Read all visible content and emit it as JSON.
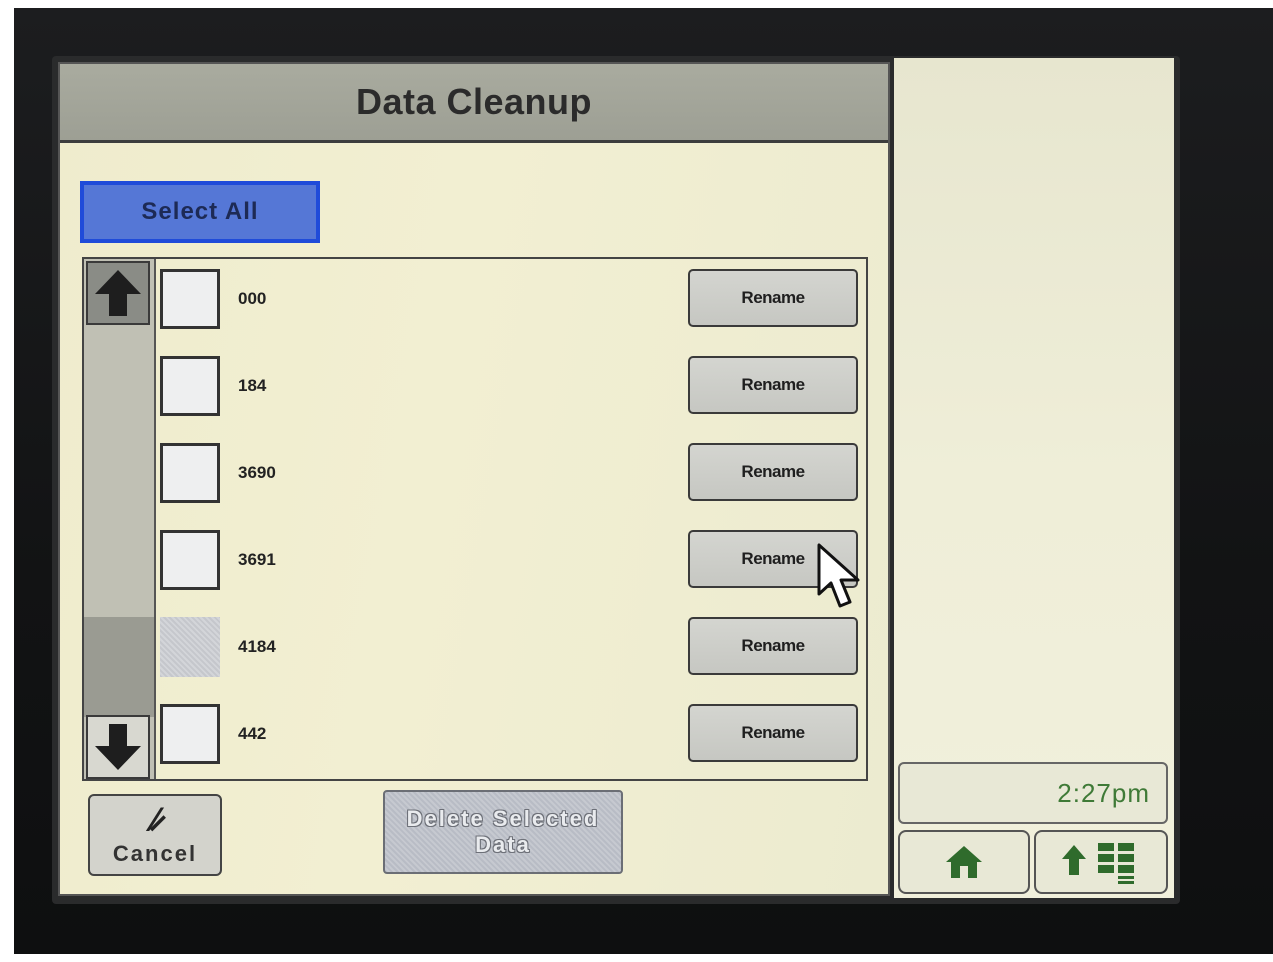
{
  "header": {
    "title": "Data Cleanup"
  },
  "actions": {
    "select_all_label": "Select All",
    "cancel_label": "Cancel",
    "delete_label_line1": "Delete Selected",
    "delete_label_line2": "Data"
  },
  "list": {
    "rename_label": "Rename",
    "items": [
      {
        "label": "000",
        "enabled": true
      },
      {
        "label": "184",
        "enabled": true
      },
      {
        "label": "3690",
        "enabled": true
      },
      {
        "label": "3691",
        "enabled": true
      },
      {
        "label": "4184",
        "enabled": false
      },
      {
        "label": "442",
        "enabled": true
      }
    ]
  },
  "status": {
    "time": "2:27pm"
  },
  "colors": {
    "select_all_blue": "#5577d6",
    "clock_green": "#3f7a37",
    "panel_bg": "#efeccd"
  }
}
